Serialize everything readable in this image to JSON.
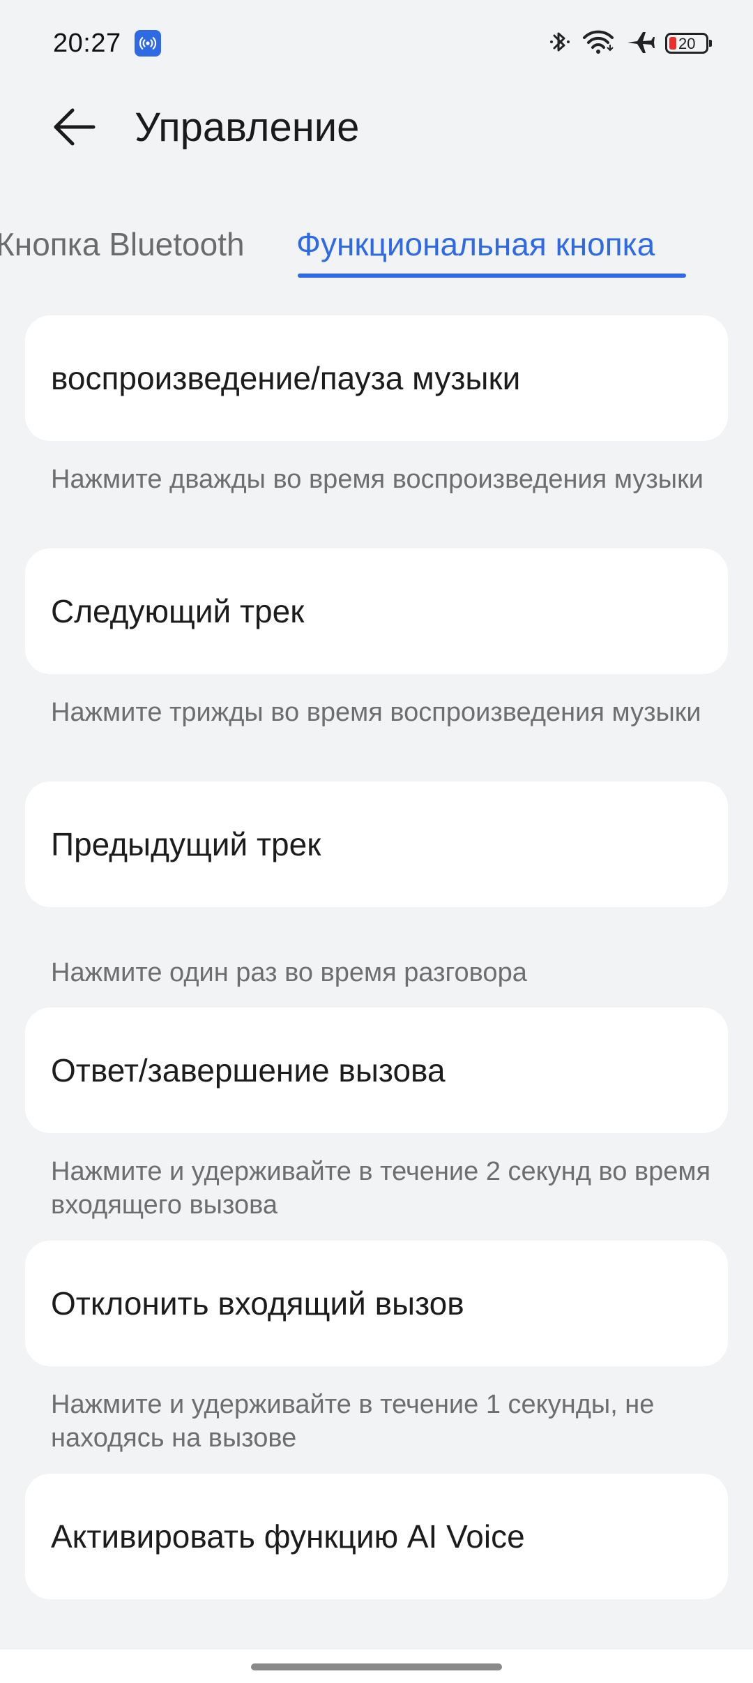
{
  "status_bar": {
    "time": "20:27",
    "battery_level": "20",
    "icons": [
      "hotspot-icon",
      "bluetooth-icon",
      "wifi-icon",
      "airplane-icon",
      "battery-icon"
    ]
  },
  "header": {
    "title": "Управление"
  },
  "tabs": [
    {
      "label": "Кнопка Bluetooth",
      "selected": false
    },
    {
      "label": "Функциональная кнопка",
      "selected": true
    }
  ],
  "items": [
    {
      "label": "воспроизведение/пауза музыки",
      "caption": "Нажмите дважды во время воспроизведения музыки"
    },
    {
      "label": "Следующий трек",
      "caption": "Нажмите трижды во время воспроизведения музыки"
    },
    {
      "label": "Предыдущий трек",
      "caption": "Нажмите один раз во время разговора"
    },
    {
      "label": "Ответ/завершение вызова",
      "caption": "Нажмите и удерживайте в течение 2 секунд во время входящего вызова"
    },
    {
      "label": "Отклонить входящий вызов",
      "caption": "Нажмите и удерживайте в течение 1 секунды, не находясь на вызове"
    },
    {
      "label": "Активировать функцию AI Voice"
    }
  ],
  "colors": {
    "accent": "#2f6ae5",
    "background": "#f1f3f5",
    "card": "#ffffff",
    "battery_low": "#e8312f"
  }
}
